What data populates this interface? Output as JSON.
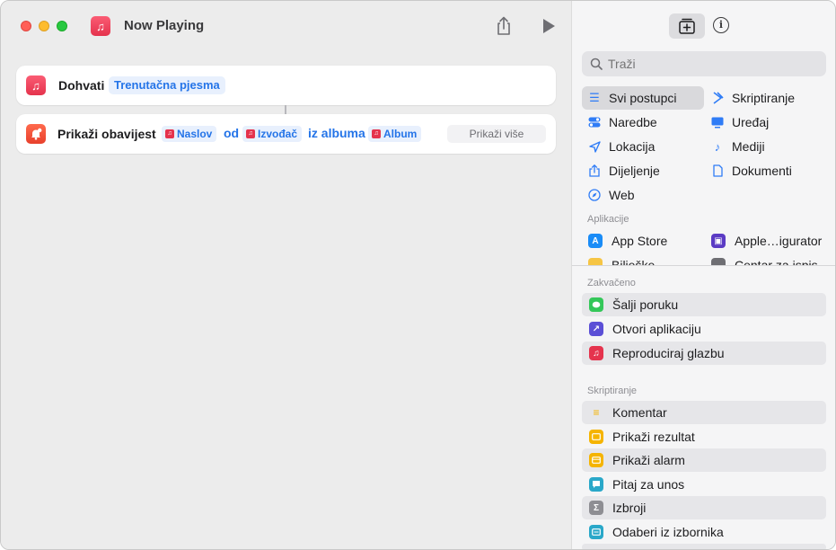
{
  "window": {
    "title": "Now Playing"
  },
  "editor": {
    "actions": [
      {
        "name": "Dohvati",
        "param": "Trenutačna pjesma"
      },
      {
        "name": "Prikaži obavijest",
        "var_title": "Naslov",
        "word_from": "od",
        "var_artist": "Izvođač",
        "word_album": "iz albuma",
        "var_album": "Album",
        "show_more": "Prikaži više"
      }
    ]
  },
  "sidebar": {
    "search_placeholder": "Traži",
    "categories": [
      {
        "label": "Svi postupci",
        "icon": "list-icon",
        "selected": true
      },
      {
        "label": "Skriptiranje",
        "icon": "scripting-icon"
      },
      {
        "label": "Naredbe",
        "icon": "toggle-icon"
      },
      {
        "label": "Uređaj",
        "icon": "display-icon"
      },
      {
        "label": "Lokacija",
        "icon": "location-arrow-icon"
      },
      {
        "label": "Mediji",
        "icon": "music-note-icon"
      },
      {
        "label": "Dijeljenje",
        "icon": "share-icon"
      },
      {
        "label": "Dokumenti",
        "icon": "document-icon"
      },
      {
        "label": "Web",
        "icon": "compass-icon"
      }
    ],
    "apps_label": "Aplikacije",
    "apps": [
      {
        "label": "App Store",
        "icon": "app-store-icon"
      },
      {
        "label": "Apple…igurator",
        "icon": "apple-configurator-icon"
      },
      {
        "label": "Bilješke",
        "icon": "notes-icon"
      },
      {
        "label": "Centar za ispis",
        "icon": "printer-icon"
      }
    ],
    "pinned_label": "Zakvačeno",
    "pinned": [
      {
        "label": "Šalji poruku",
        "icon": "messages-icon"
      },
      {
        "label": "Otvori aplikaciju",
        "icon": "open-app-icon"
      },
      {
        "label": "Reproduciraj glazbu",
        "icon": "music-icon"
      }
    ],
    "scripting_label": "Skriptiranje",
    "scripting": [
      {
        "label": "Komentar",
        "icon": "comment-icon"
      },
      {
        "label": "Prikaži rezultat",
        "icon": "show-result-icon"
      },
      {
        "label": "Prikaži alarm",
        "icon": "alert-icon"
      },
      {
        "label": "Pitaj za unos",
        "icon": "ask-input-icon"
      },
      {
        "label": "Izbroji",
        "icon": "count-icon"
      },
      {
        "label": "Odaberi iz izbornika",
        "icon": "menu-icon"
      }
    ]
  }
}
